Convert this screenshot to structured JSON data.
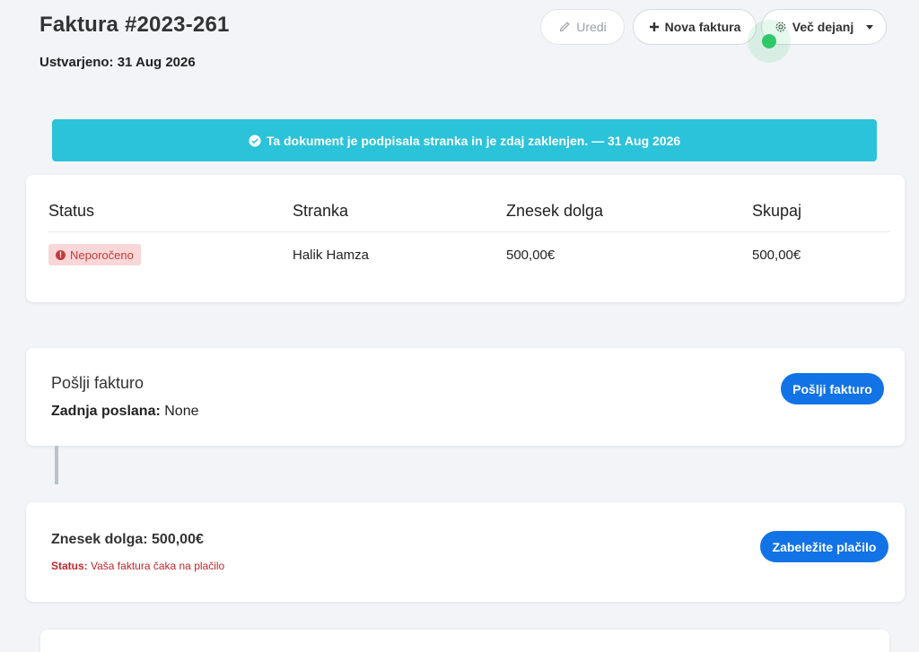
{
  "header": {
    "title": "Faktura #2023-261",
    "created_label": "Ustvarjeno:",
    "created_value": "31 Aug 2026"
  },
  "toolbar": {
    "edit_label": "Uredi",
    "new_label": "Nova faktura",
    "more_label": "Več dejanj"
  },
  "alert": {
    "text": "Ta dokument je podpisala stranka in je zdaj zaklenjen. — 31 Aug 2026",
    "color": "#2bc3da"
  },
  "summary": {
    "headers": [
      "Status",
      "Stranka",
      "Znesek dolga",
      "Skupaj"
    ],
    "status_badge": "Neporočeno",
    "customer": "Halik Hamza",
    "amount_due": "500,00€",
    "total": "500,00€"
  },
  "send": {
    "title": "Pošlji fakturo",
    "last_sent_label": "Zadnja poslana:",
    "last_sent_value": "None",
    "button_label": "Pošlji fakturo"
  },
  "payment": {
    "amount_label": "Znesek dolga: 500,00€",
    "status_label": "Status:",
    "status_text": "Vaša faktura čaka na plačilo",
    "button_label": "Zabeležite plačilo"
  },
  "colors": {
    "primary": "#1273e6",
    "danger": "#c53b3b"
  }
}
